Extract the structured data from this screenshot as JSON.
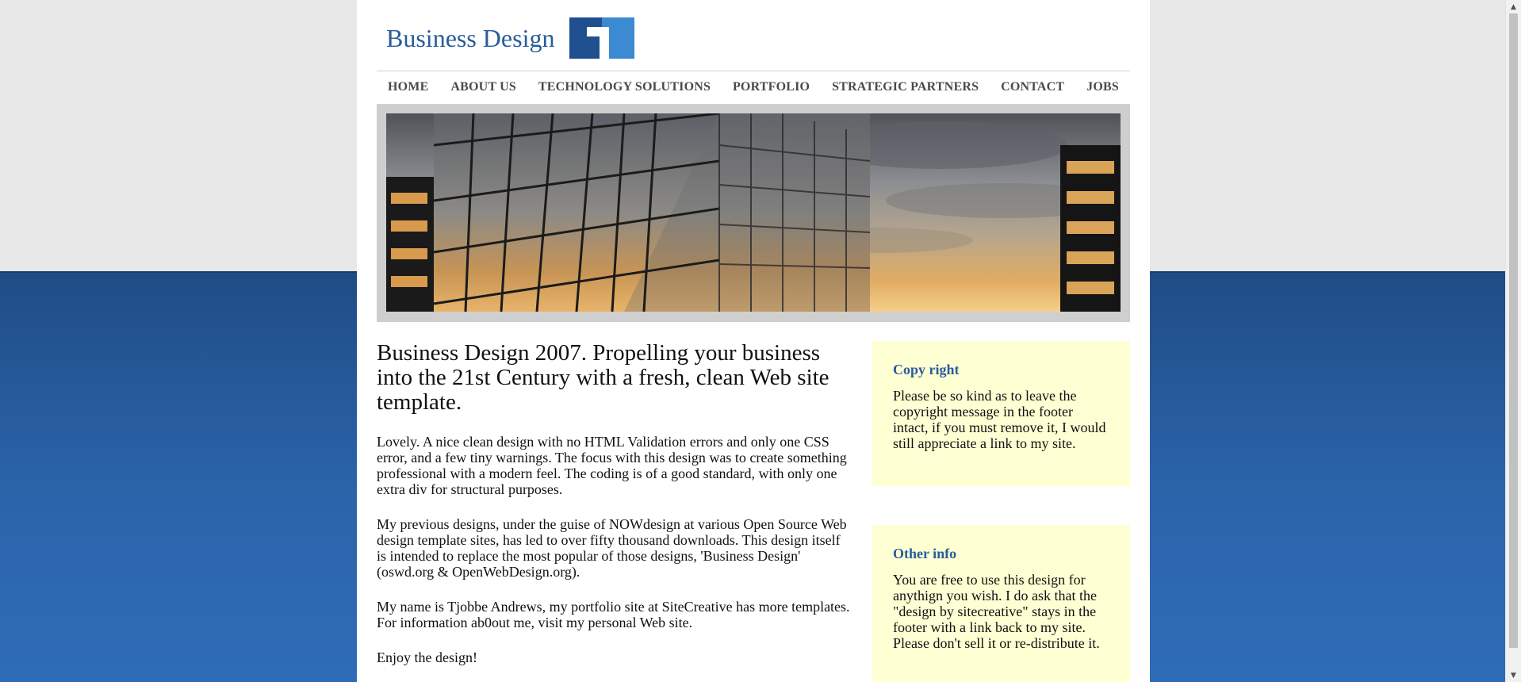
{
  "site": {
    "logo_text": "Business Design"
  },
  "nav": {
    "items": [
      {
        "label": "HOME"
      },
      {
        "label": "ABOUT US"
      },
      {
        "label": "TECHNOLOGY SOLUTIONS"
      },
      {
        "label": "PORTFOLIO"
      },
      {
        "label": "STRATEGIC PARTNERS"
      },
      {
        "label": "CONTACT"
      },
      {
        "label": "JOBS"
      }
    ]
  },
  "main": {
    "heading": "Business Design 2007. Propelling your business into the 21st Century with a fresh, clean Web site template.",
    "paragraphs": [
      "Lovely. A nice clean design with no HTML Validation errors and only one CSS error, and a few tiny warnings. The focus with this design was to create something professional with a modern feel. The coding is of a good standard, with only one extra div for structural purposes.",
      "My previous designs, under the guise of NOWdesign at various Open Source Web design template sites, has led to over fifty thousand downloads. This design itself is intended to replace the most popular of those designs, 'Business Design' (oswd.org & OpenWebDesign.org).",
      "My name is Tjobbe Andrews, my portfolio site at SiteCreative has more templates. For information ab0out me, visit my personal Web site.",
      "Enjoy the design!"
    ]
  },
  "sidebar": {
    "boxes": [
      {
        "title": "Copy right",
        "text": "Please be so kind as to leave the copyright message in the footer intact, if you must remove it, I would still appreciate a link to my site."
      },
      {
        "title": "Other info",
        "text": "You are free to use this design for anythign you wish. I do ask that the \"design by sitecreative\" stays in the footer with a link back to my site. Please don't sell it or re-distribute it."
      }
    ]
  },
  "colors": {
    "brand_blue": "#2a5c9c",
    "logo_dark": "#1f4f8f",
    "logo_light": "#3c8ad2",
    "sidebar_bg": "#ffffd4",
    "bottom_bg": "#2a63a8"
  },
  "icons": {
    "logo_mark": "square-logo-icon",
    "scroll_up": "arrow-up-icon",
    "scroll_down": "arrow-down-icon"
  }
}
